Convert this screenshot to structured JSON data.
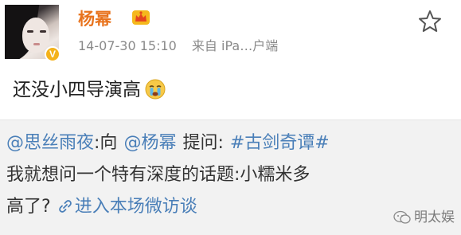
{
  "post": {
    "user": {
      "name": "杨幂",
      "verified_badge": "V",
      "avatar": "avatar",
      "badge_icon": "crown-icon"
    },
    "timestamp": "14-07-30 15:10",
    "source": "来自 iPa…户端",
    "favorite_icon": "star-icon",
    "text": "还没小四导演高",
    "emoji": "crying-face-icon"
  },
  "repost": {
    "mention_user": "@思丝雨夜",
    "to_word": ":向",
    "mention_target": "@杨幂",
    "ask_label": "提问:",
    "topic": "#古剑奇谭#",
    "question_line1": "我就想问一个特有深度的话题:小糯米多",
    "question_line2": "高了?",
    "link_icon": "link-icon",
    "link_text": "进入本场微访谈"
  },
  "watermark": {
    "text": "明太娱",
    "icon": "chat-bubble-icon"
  },
  "colors": {
    "username": "#e8731d",
    "link": "#4a7fb8",
    "repost_bg": "#f2f2f2",
    "badge": "#f4b21b"
  }
}
